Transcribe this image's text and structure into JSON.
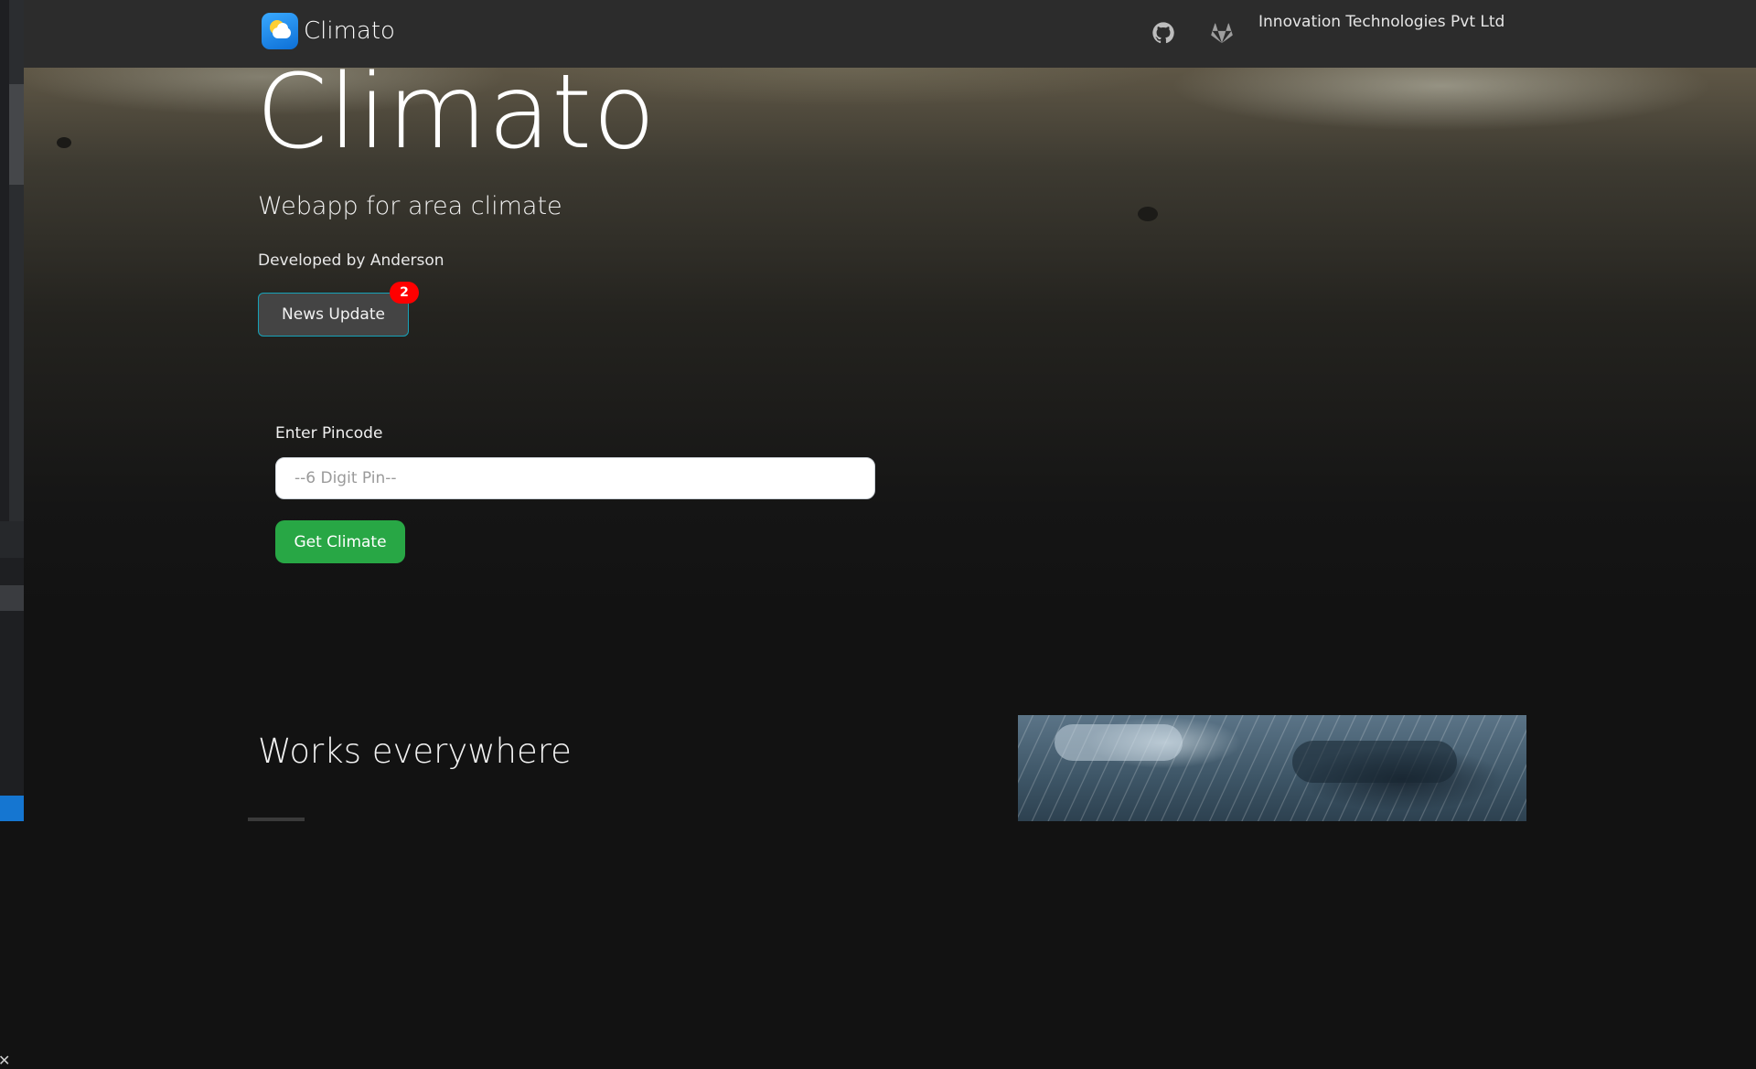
{
  "navbar": {
    "brand_name": "Climato",
    "company": "Innovation Technologies Pvt Ltd",
    "icons": [
      "github-icon",
      "gitlab-icon"
    ]
  },
  "hero": {
    "title": "Climato",
    "subtitle": "Webapp for area climate",
    "developer": "Developed by Anderson",
    "news_button_label": "News Update",
    "news_badge_count": "2"
  },
  "pincode": {
    "label": "Enter Pincode",
    "placeholder": "--6 Digit Pin--",
    "value": "",
    "submit_label": "Get Climate"
  },
  "features": {
    "title": "Works everywhere"
  },
  "colors": {
    "navbar_bg": "#2c2c2c",
    "page_bg": "#121212",
    "primary_action": "#28a745",
    "badge": "#ff0000",
    "news_border": "#17a2b8"
  }
}
